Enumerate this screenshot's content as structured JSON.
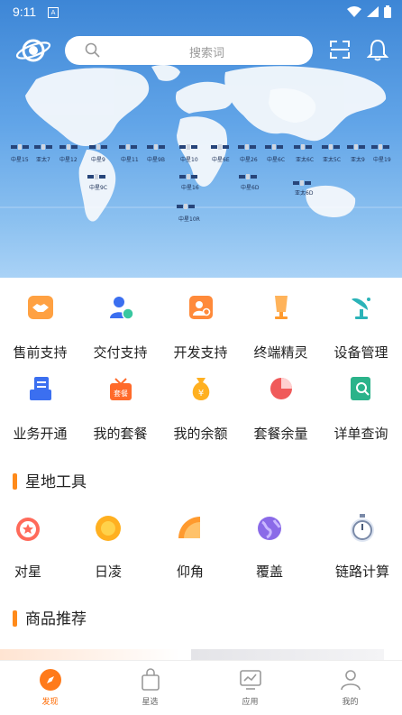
{
  "status_bar": {
    "time": "9:11",
    "notice_glyph": "A",
    "icons": [
      "wifi-icon",
      "signal-icon",
      "battery-icon"
    ]
  },
  "header": {
    "search_placeholder": "搜索词"
  },
  "map": {
    "satellites": [
      "中星15",
      "亚太7",
      "中星12",
      "中星9",
      "中星11",
      "中星9B",
      "中星10",
      "中星6E",
      "中星26",
      "中星6C",
      "亚太6C",
      "亚太5C",
      "亚太9",
      "中星19",
      "中星9C",
      "中星16",
      "中星6D",
      "亚太6D",
      "中星10R"
    ]
  },
  "services": [
    {
      "label": "售前支持",
      "icon": "handshake-icon"
    },
    {
      "label": "交付支持",
      "icon": "delivery-user-icon"
    },
    {
      "label": "开发支持",
      "icon": "developer-icon"
    },
    {
      "label": "终端精灵",
      "icon": "terminal-dish-icon"
    },
    {
      "label": "设备管理",
      "icon": "satellite-dish-icon"
    },
    {
      "label": "业务开通",
      "icon": "business-open-icon"
    },
    {
      "label": "我的套餐",
      "icon": "package-icon"
    },
    {
      "label": "我的余额",
      "icon": "money-bag-icon"
    },
    {
      "label": "套餐余量",
      "icon": "pie-chart-icon"
    },
    {
      "label": "详单查询",
      "icon": "detail-search-icon"
    }
  ],
  "tools_section": {
    "title": "星地工具",
    "items": [
      {
        "label": "对星",
        "icon": "alarm-star-icon"
      },
      {
        "label": "日凌",
        "icon": "sun-icon"
      },
      {
        "label": "仰角",
        "icon": "protractor-icon"
      },
      {
        "label": "覆盖",
        "icon": "globe-icon"
      },
      {
        "label": "链路计算",
        "icon": "stopwatch-icon"
      }
    ]
  },
  "goods_section": {
    "title": "商品推荐"
  },
  "tabbar": [
    {
      "label": "发现",
      "icon": "compass-icon",
      "active": true
    },
    {
      "label": "星选",
      "icon": "shopping-bag-icon",
      "active": false
    },
    {
      "label": "应用",
      "icon": "monitor-chart-icon",
      "active": false
    },
    {
      "label": "我的",
      "icon": "user-icon",
      "active": false
    }
  ],
  "colors": {
    "accent": "#ff8a1a",
    "tab_active": "#ff6a00",
    "hero_top": "#3d86d6"
  }
}
